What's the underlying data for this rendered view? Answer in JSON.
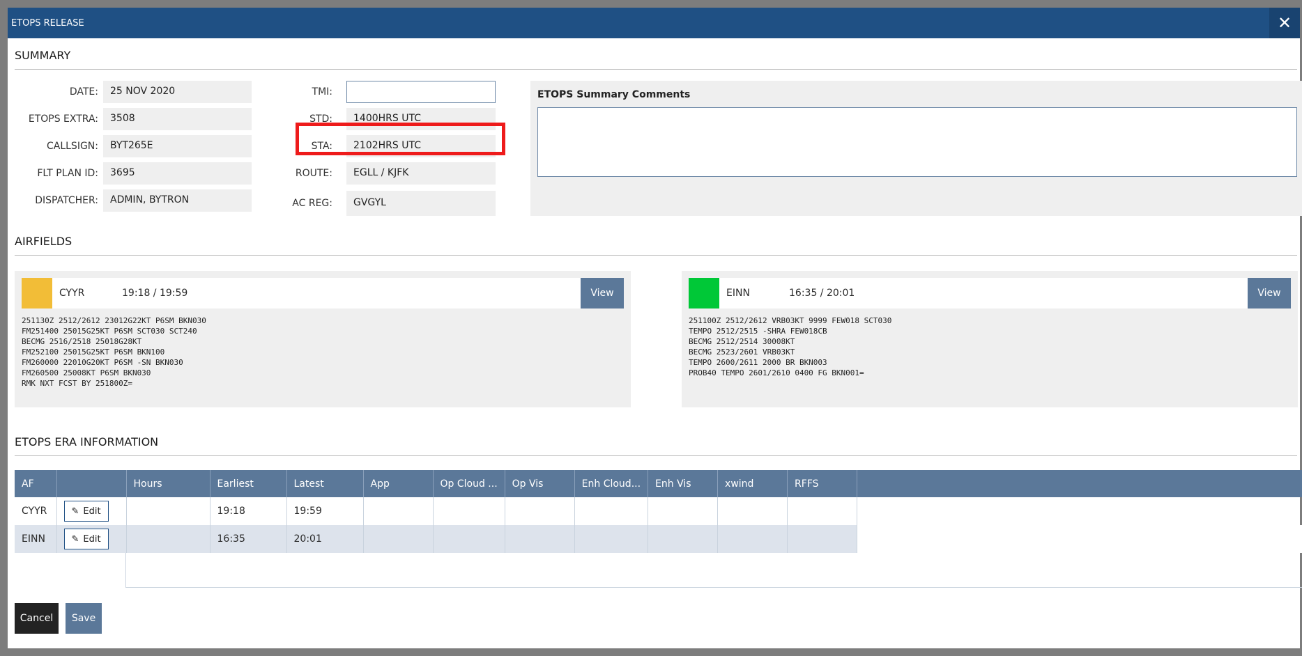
{
  "window": {
    "title": "ETOPS RELEASE",
    "close_glyph": "✕"
  },
  "summary": {
    "section_title": "SUMMARY",
    "left": [
      {
        "label": "DATE:",
        "value": "25 NOV 2020"
      },
      {
        "label": "ETOPS EXTRA:",
        "value": "3508"
      },
      {
        "label": "CALLSIGN:",
        "value": "BYT265E"
      },
      {
        "label": "FLT PLAN ID:",
        "value": "3695"
      },
      {
        "label": "DISPATCHER:",
        "value": "ADMIN, BYTRON"
      }
    ],
    "right": [
      {
        "label": "TMI:",
        "value": ""
      },
      {
        "label": "STD:",
        "value": "1400HRS UTC"
      },
      {
        "label": "STA:",
        "value": "2102HRS UTC"
      },
      {
        "label": "ROUTE:",
        "value": "EGLL / KJFK"
      },
      {
        "label": "AC REG:",
        "value": "GVGYL"
      }
    ],
    "comments_label": "ETOPS Summary Comments",
    "comments_value": "",
    "highlight_color": "#ee1b1b"
  },
  "airfields": {
    "section_title": "AIRFIELDS",
    "cards": [
      {
        "code": "CYYR",
        "time": "19:18 / 19:59",
        "status_color": "#f2bd37",
        "view_label": "View",
        "taf": "251130Z 2512/2612 23012G22KT P6SM BKN030\nFM251400 25015G25KT P6SM SCT030 SCT240\nBECMG 2516/2518 25018G28KT\nFM252100 25015G25KT P6SM BKN100\nFM260000 22010G20KT P6SM -SN BKN030\nFM260500 25008KT P6SM BKN030\nRMK NXT FCST BY 251800Z="
      },
      {
        "code": "EINN",
        "time": "16:35 / 20:01",
        "status_color": "#00c837",
        "view_label": "View",
        "taf": "251100Z 2512/2612 VRB03KT 9999 FEW018 SCT030\nTEMPO 2512/2515 -SHRA FEW018CB\nBECMG 2512/2514 30008KT\nBECMG 2523/2601 VRB03KT\nTEMPO 2600/2611 2000 BR BKN003\nPROB40 TEMPO 2601/2610 0400 FG BKN001="
      }
    ]
  },
  "era": {
    "section_title": "ETOPS ERA INFORMATION",
    "columns": [
      "AF",
      "",
      "Hours",
      "Earliest",
      "Latest",
      "App",
      "Op Cloud ...",
      "Op Vis",
      "Enh Cloud...",
      "Enh Vis",
      "xwind",
      "RFFS"
    ],
    "rows": [
      {
        "af": "CYYR",
        "edit_label": "Edit",
        "hours": "",
        "earliest": "19:18",
        "latest": "19:59"
      },
      {
        "af": "EINN",
        "edit_label": "Edit",
        "hours": "",
        "earliest": "16:35",
        "latest": "20:01"
      }
    ]
  },
  "footer": {
    "cancel_label": "Cancel",
    "save_label": "Save"
  }
}
